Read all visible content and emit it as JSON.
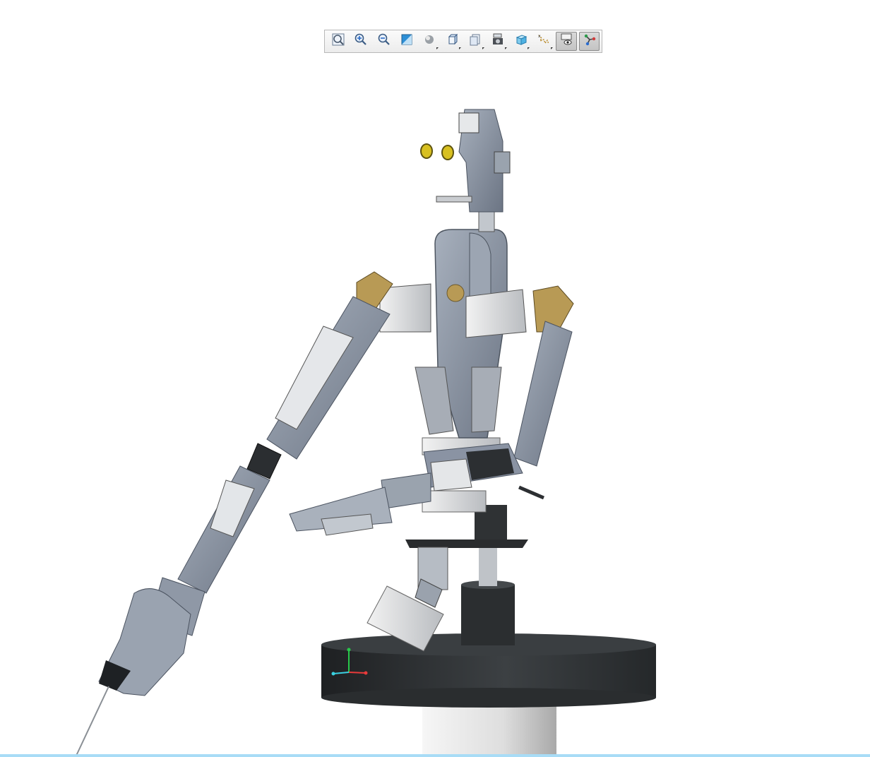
{
  "toolbar": {
    "buttons": [
      {
        "name": "zoom-to-fit",
        "icon": "zoom-fit-icon"
      },
      {
        "name": "zoom-in",
        "icon": "zoom-in-icon"
      },
      {
        "name": "zoom-out",
        "icon": "zoom-out-icon"
      },
      {
        "name": "section-view",
        "icon": "section-view-icon"
      },
      {
        "name": "display-style",
        "icon": "display-style-icon"
      },
      {
        "name": "view-orientation",
        "icon": "view-cube-icon"
      },
      {
        "name": "previous-view",
        "icon": "previous-view-icon"
      },
      {
        "name": "scene-settings",
        "icon": "camera-icon"
      },
      {
        "name": "view-settings",
        "icon": "transparent-cube-icon"
      },
      {
        "name": "hide-show",
        "icon": "axis-scatter-icon"
      },
      {
        "name": "hide-show-items",
        "icon": "eye-screen-icon",
        "active": true
      },
      {
        "name": "joint-display",
        "icon": "link-nodes-icon",
        "active": true
      }
    ]
  },
  "colors": {
    "background": "#ffffff",
    "robot_steel": "#8a93a3",
    "brass": "#b89a55",
    "base_black": "#2e3133",
    "pedestal_white": "#e8e8e8",
    "bottom_bar": "#a8dcf6"
  }
}
